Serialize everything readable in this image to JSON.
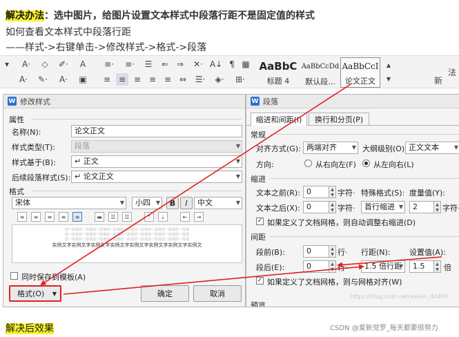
{
  "header": {
    "label": "解决办法",
    "title": "：选中图片，给图片设置文本样式中段落行距不是固定值的样式",
    "line2": "如何查看文本样式中段落行距",
    "line3": "——样式->右键单击->修改样式->格式->段落"
  },
  "ribbon": {
    "row1_icons": [
      "▾",
      "A·",
      "◇",
      "✐·",
      "A",
      "A",
      "≡·",
      "≡·",
      "☰",
      "⇐",
      "⇒",
      "✕·",
      "A↓",
      "¶",
      "▦"
    ],
    "row2_icons": [
      "A·",
      "✎·",
      "A·",
      "▣",
      "≡",
      "≡",
      "≡",
      "≡",
      "≡",
      "⇔",
      "☰·",
      "◈·",
      "⊞·"
    ],
    "styles": [
      {
        "sample": "AaBbC",
        "caption": "标题 4"
      },
      {
        "sample": "AaBbCcDd",
        "caption": "默认段..."
      },
      {
        "sample": "AaBbCcI",
        "caption": "论文正文"
      }
    ],
    "right_glyphs": [
      "▲",
      "▼",
      "新",
      "法"
    ]
  },
  "modify_dialog": {
    "title": "修改样式",
    "app_icon": "W",
    "props_header": "属性",
    "name_label": "名称(N):",
    "name_value": "论文正文",
    "type_label": "样式类型(T):",
    "type_value": "段落",
    "based_label": "样式基于(B):",
    "based_value": "↵ 正文",
    "next_label": "后续段落样式(S):",
    "next_value": "↵ 论文正文",
    "format_header": "格式",
    "font": "宋体",
    "size": "小四",
    "bold": "B",
    "italic": "I",
    "lang": "中文",
    "preview_grey": "前一段落前一段落前一段落前一段落前一段落前一段落前一段落前一段落前一段落",
    "preview_text": "实例文字实例文字实例文字实例文字实例文字实例文字实例文字实例文",
    "add_template_label": "同时保存到模板(A)",
    "format_btn": "格式(O)",
    "ok_btn": "确定",
    "cancel_btn": "取消"
  },
  "paragraph_dialog": {
    "title": "段落",
    "app_icon": "W",
    "tabs": [
      "缩进和间距(I)",
      "换行和分页(P)"
    ],
    "general_header": "常规",
    "align_label": "对齐方式(G):",
    "align_value": "两端对齐",
    "outline_label": "大纲级别(O):",
    "outline_value": "正文文本",
    "dir_label": "方向:",
    "dir_rtl": "从右向左(F)",
    "dir_ltr": "从左向右(L)",
    "indent_header": "缩进",
    "before_text_label": "文本之前(R):",
    "before_text_value": "0",
    "after_text_label": "文本之后(X):",
    "after_text_value": "0",
    "char_unit": "字符·",
    "special_label": "特殊格式(S):",
    "special_value": "首行缩进",
    "measure_label": "度量值(Y):",
    "measure_value": "2",
    "measure_unit": "字符·",
    "auto_indent_label": "如果定义了文档网格，则自动调整右缩进(D)",
    "spacing_header": "间距",
    "before_label": "段前(B):",
    "before_value": "0",
    "after_label": "段后(E):",
    "after_value": "0",
    "line_unit": "行·",
    "linespacing_label": "行距(N):",
    "linespacing_value": "1.5 倍行距",
    "setval_label": "设置值(A):",
    "setval_value": "1.5",
    "setval_unit": "倍",
    "grid_label": "如果定义了文档网格，则与网格对齐(W)",
    "preview_header": "预览"
  },
  "footer": {
    "label": "解决后效果",
    "watermark_url": "https://blog.csdn.net/weixin_40409",
    "watermark_credit": "CSDN @爱新觉罗_每天都要很努力"
  },
  "colors": {
    "highlight": "#f7f22a",
    "arrow": "#e02020",
    "wps_blue": "#2b6fcf"
  }
}
